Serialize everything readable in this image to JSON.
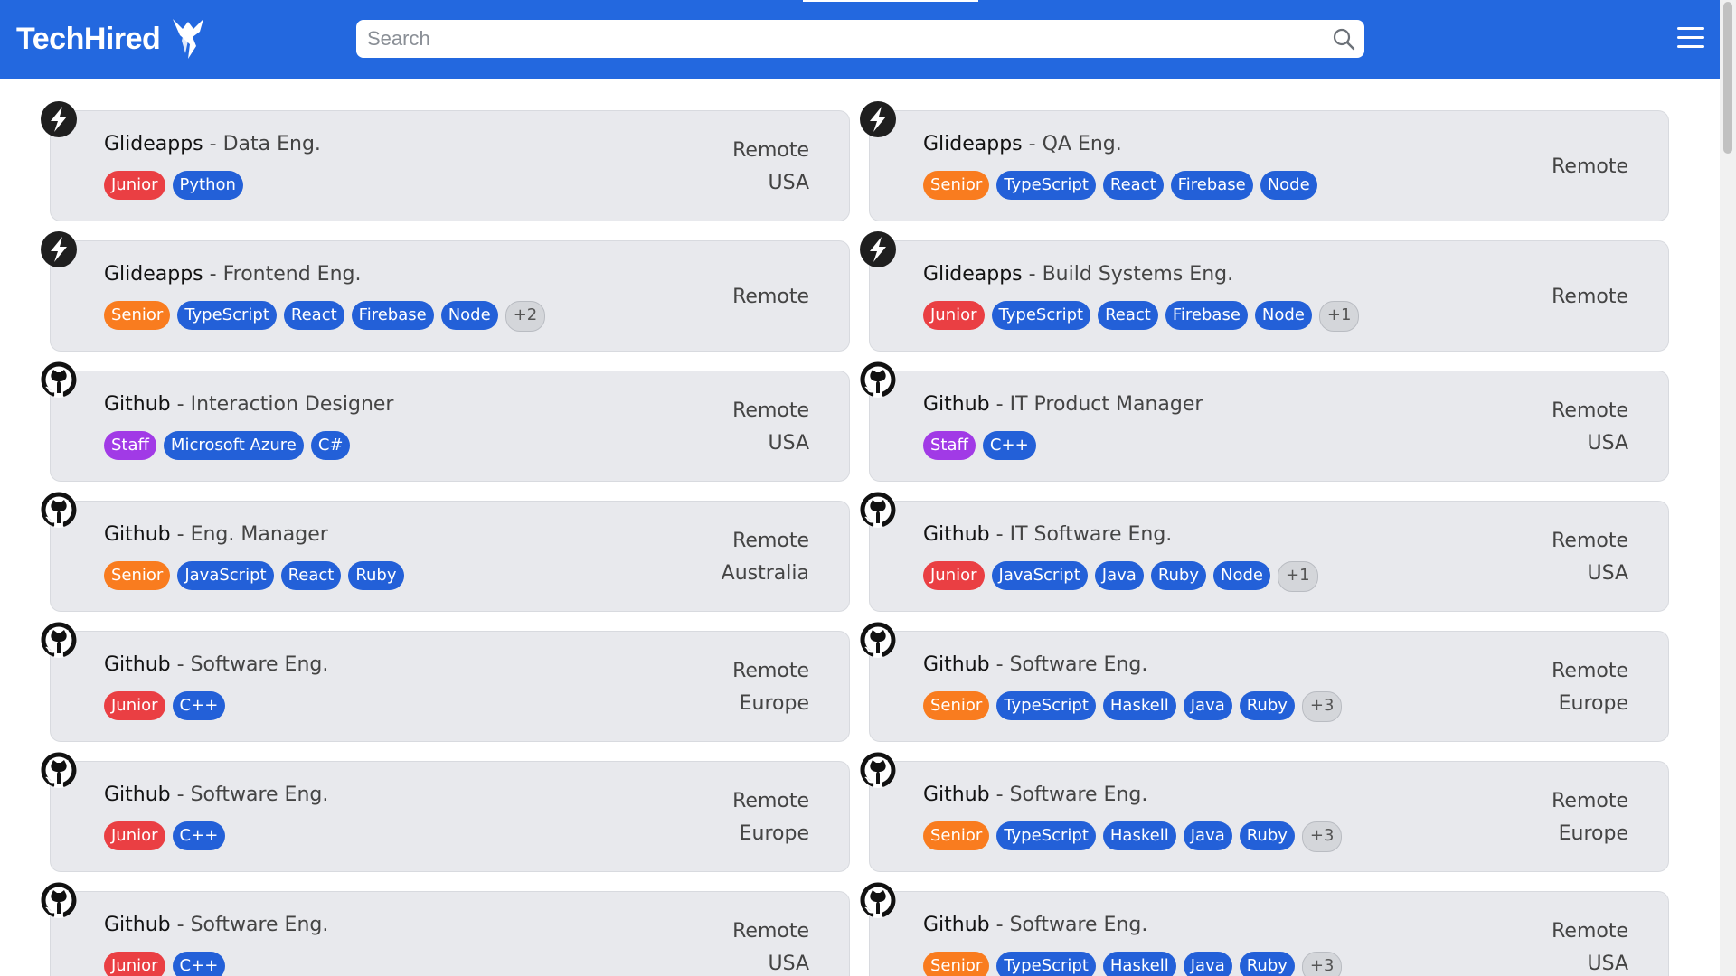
{
  "header": {
    "brand": "TechHired",
    "search_placeholder": "Search"
  },
  "colors": {
    "header": "#2368df",
    "tag_junior": "#ea3f43",
    "tag_senior": "#f97c1f",
    "tag_staff": "#a13ae6",
    "tag_tech": "#2360d8",
    "tag_more": "#d4d6da"
  },
  "jobs": [
    {
      "company": "Glideapps",
      "role": "Data Eng.",
      "logo": "bolt-icon",
      "tags": [
        {
          "text": "Junior",
          "kind": "junior"
        },
        {
          "text": "Python",
          "kind": "tech"
        }
      ],
      "location": [
        "Remote",
        "USA"
      ]
    },
    {
      "company": "Glideapps",
      "role": "QA Eng.",
      "logo": "bolt-icon",
      "tags": [
        {
          "text": "Senior",
          "kind": "senior"
        },
        {
          "text": "TypeScript",
          "kind": "tech"
        },
        {
          "text": "React",
          "kind": "tech"
        },
        {
          "text": "Firebase",
          "kind": "tech"
        },
        {
          "text": "Node",
          "kind": "tech"
        }
      ],
      "location": [
        "Remote"
      ]
    },
    {
      "company": "Glideapps",
      "role": "Frontend Eng.",
      "logo": "bolt-icon",
      "tags": [
        {
          "text": "Senior",
          "kind": "senior"
        },
        {
          "text": "TypeScript",
          "kind": "tech"
        },
        {
          "text": "React",
          "kind": "tech"
        },
        {
          "text": "Firebase",
          "kind": "tech"
        },
        {
          "text": "Node",
          "kind": "tech"
        },
        {
          "text": "+2",
          "kind": "more"
        }
      ],
      "location": [
        "Remote"
      ]
    },
    {
      "company": "Glideapps",
      "role": "Build Systems Eng.",
      "logo": "bolt-icon",
      "tags": [
        {
          "text": "Junior",
          "kind": "junior"
        },
        {
          "text": "TypeScript",
          "kind": "tech"
        },
        {
          "text": "React",
          "kind": "tech"
        },
        {
          "text": "Firebase",
          "kind": "tech"
        },
        {
          "text": "Node",
          "kind": "tech"
        },
        {
          "text": "+1",
          "kind": "more"
        }
      ],
      "location": [
        "Remote"
      ]
    },
    {
      "company": "Github",
      "role": "Interaction Designer",
      "logo": "github-icon",
      "tags": [
        {
          "text": "Staff",
          "kind": "staff"
        },
        {
          "text": "Microsoft Azure",
          "kind": "tech"
        },
        {
          "text": "C#",
          "kind": "tech"
        }
      ],
      "location": [
        "Remote",
        "USA"
      ]
    },
    {
      "company": "Github",
      "role": "IT Product Manager",
      "logo": "github-icon",
      "tags": [
        {
          "text": "Staff",
          "kind": "staff"
        },
        {
          "text": "C++",
          "kind": "tech"
        }
      ],
      "location": [
        "Remote",
        "USA"
      ]
    },
    {
      "company": "Github",
      "role": "Eng. Manager",
      "logo": "github-icon",
      "tags": [
        {
          "text": "Senior",
          "kind": "senior"
        },
        {
          "text": "JavaScript",
          "kind": "tech"
        },
        {
          "text": "React",
          "kind": "tech"
        },
        {
          "text": "Ruby",
          "kind": "tech"
        }
      ],
      "location": [
        "Remote",
        "Australia"
      ]
    },
    {
      "company": "Github",
      "role": "IT Software Eng.",
      "logo": "github-icon",
      "tags": [
        {
          "text": "Junior",
          "kind": "junior"
        },
        {
          "text": "JavaScript",
          "kind": "tech"
        },
        {
          "text": "Java",
          "kind": "tech"
        },
        {
          "text": "Ruby",
          "kind": "tech"
        },
        {
          "text": "Node",
          "kind": "tech"
        },
        {
          "text": "+1",
          "kind": "more"
        }
      ],
      "location": [
        "Remote",
        "USA"
      ]
    },
    {
      "company": "Github",
      "role": "Software Eng.",
      "logo": "github-icon",
      "tags": [
        {
          "text": "Junior",
          "kind": "junior"
        },
        {
          "text": "C++",
          "kind": "tech"
        }
      ],
      "location": [
        "Remote",
        "Europe"
      ]
    },
    {
      "company": "Github",
      "role": "Software Eng.",
      "logo": "github-icon",
      "tags": [
        {
          "text": "Senior",
          "kind": "senior"
        },
        {
          "text": "TypeScript",
          "kind": "tech"
        },
        {
          "text": "Haskell",
          "kind": "tech"
        },
        {
          "text": "Java",
          "kind": "tech"
        },
        {
          "text": "Ruby",
          "kind": "tech"
        },
        {
          "text": "+3",
          "kind": "more"
        }
      ],
      "location": [
        "Remote",
        "Europe"
      ]
    },
    {
      "company": "Github",
      "role": "Software Eng.",
      "logo": "github-icon",
      "tags": [
        {
          "text": "Junior",
          "kind": "junior"
        },
        {
          "text": "C++",
          "kind": "tech"
        }
      ],
      "location": [
        "Remote",
        "Europe"
      ]
    },
    {
      "company": "Github",
      "role": "Software Eng.",
      "logo": "github-icon",
      "tags": [
        {
          "text": "Senior",
          "kind": "senior"
        },
        {
          "text": "TypeScript",
          "kind": "tech"
        },
        {
          "text": "Haskell",
          "kind": "tech"
        },
        {
          "text": "Java",
          "kind": "tech"
        },
        {
          "text": "Ruby",
          "kind": "tech"
        },
        {
          "text": "+3",
          "kind": "more"
        }
      ],
      "location": [
        "Remote",
        "Europe"
      ]
    },
    {
      "company": "Github",
      "role": "Software Eng.",
      "logo": "github-icon",
      "tags": [
        {
          "text": "Junior",
          "kind": "junior"
        },
        {
          "text": "C++",
          "kind": "tech"
        }
      ],
      "location": [
        "Remote",
        "USA"
      ]
    },
    {
      "company": "Github",
      "role": "Software Eng.",
      "logo": "github-icon",
      "tags": [
        {
          "text": "Senior",
          "kind": "senior"
        },
        {
          "text": "TypeScript",
          "kind": "tech"
        },
        {
          "text": "Haskell",
          "kind": "tech"
        },
        {
          "text": "Java",
          "kind": "tech"
        },
        {
          "text": "Ruby",
          "kind": "tech"
        },
        {
          "text": "+3",
          "kind": "more"
        }
      ],
      "location": [
        "Remote",
        "USA"
      ]
    }
  ]
}
